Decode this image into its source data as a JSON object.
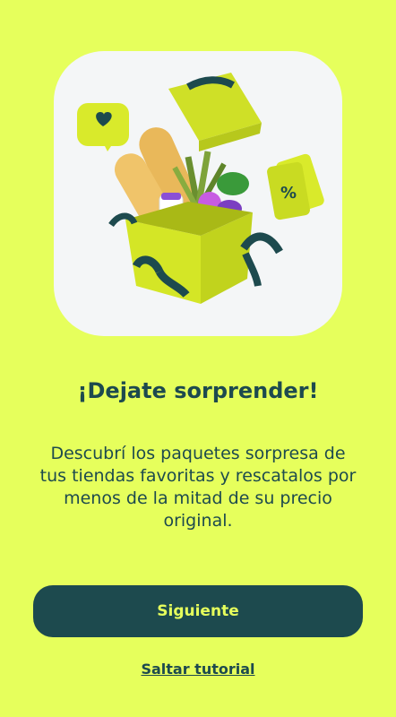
{
  "onboarding": {
    "illustration": "gift-box-with-groceries",
    "title": "¡Dejate sorprender!",
    "description": "Descubrí los paquetes sorpresa de tus tiendas favoritas y rescatalos por menos de la mitad de su precio original.",
    "next_label": "Siguiente",
    "skip_label": "Saltar tutorial"
  },
  "colors": {
    "background": "#e6ff5c",
    "primary": "#1d4a4e",
    "card": "#f4f6f7",
    "box": "#d4e626"
  }
}
